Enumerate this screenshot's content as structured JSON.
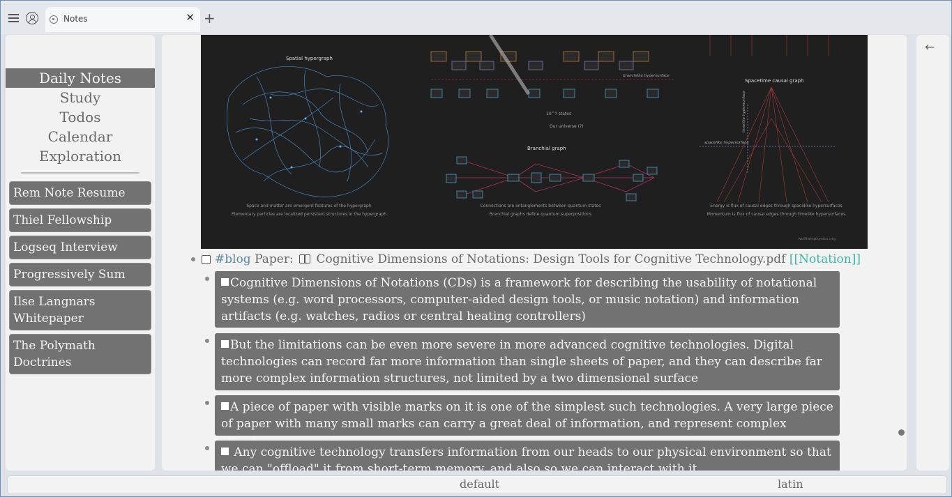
{
  "tab": {
    "title": "Notes"
  },
  "sidebar": {
    "nav": [
      "Daily Notes",
      "Study",
      "Todos",
      "Calendar",
      "Exploration"
    ],
    "pages": [
      "Rem Note Resume",
      "Thiel Fellowship",
      "Logseq Interview",
      "Progressively Sum",
      "Ilse Langnars Whitepaper",
      "The Polymath Doctrines"
    ]
  },
  "figure": {
    "spatial_title": "Spatial hypergraph",
    "spatial_caption_1": "Space and matter are emergent features of the hypergraph",
    "spatial_caption_2": "Elementary particles are localized persistent structures in the hypergraph",
    "branchial_title": "Branchial graph",
    "branchial_caption_1": "Connections are entanglements between quantum states",
    "branchial_caption_2": "Branchial graphs define quantum superpositions",
    "causal_title": "Spacetime causal graph",
    "causal_caption_1": "Energy is flux of causal edges through spacelike hypersurfaces",
    "causal_caption_2": "Momentum is flux of causal edges through timelike hypersurfaces",
    "branchlike_label": "branchlike hypersurface",
    "timelike_label": "timelike hypersurface",
    "spacelike_label": "spacelike hypersurface",
    "states_label": "10^? states",
    "universe_label": "Our universe (?)",
    "credit": "wolframphysics.org"
  },
  "block": {
    "tag": "#blog",
    "prefix": "Paper:",
    "pdf_title": "Cognitive Dimensions of Notations: Design Tools for Cognitive Technology.pdf",
    "link": "[[Notation]]"
  },
  "cards": [
    "Cognitive Dimensions of Notations (CDs) is a framework for describing the usability of notational systems (e.g. word processors, computer-aided design tools, or music notation) and information artifacts (e.g. watches, radios or central heating controllers)",
    "But the limitations can be even more severe in more advanced cognitive technologies. Digital technologies can record far more information than single sheets of paper, and they can describe far more complex information structures, not limited by a two dimensional surface",
    "A piece of paper with visible marks on it is one of the simplest such technologies. A very large piece of paper with many small marks can carry a great deal of information, and represent complex structures.",
    " Any cognitive technology transfers information from our heads to our physical environment so that we can \"offload\" it from short-term memory, and also so we can interact with it"
  ],
  "footer": {
    "left": "default",
    "right": "latin"
  },
  "colors": {
    "accent_link": "#3bb6a6",
    "tag": "#5b8aa0",
    "card_bg": "#727272"
  }
}
